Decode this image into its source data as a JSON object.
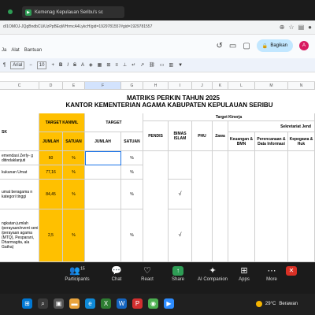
{
  "zoom": {
    "tab_title": "Kemenag Kepulauan Seribu's sc",
    "bottom": [
      {
        "label": "Participants",
        "icon": "participants-icon"
      },
      {
        "label": "Chat",
        "icon": "chat-icon"
      },
      {
        "label": "React",
        "icon": "react-icon"
      },
      {
        "label": "Share",
        "icon": "share-icon"
      },
      {
        "label": "AI Companion",
        "icon": "ai-companion-icon"
      },
      {
        "label": "Apps",
        "icon": "apps-icon"
      },
      {
        "label": "More",
        "icon": "more-icon"
      }
    ],
    "participant_count": "15"
  },
  "browser": {
    "url": "d/1OMOJ-JQgBndbCUiUzPpBEqWHrmcA4LykcH/gid=1929781557#gid=1929781557",
    "share_label": "Bagikan",
    "avatar_letter": "A"
  },
  "menu": [
    "Ja",
    "Alat",
    "Bantuan"
  ],
  "toolbar": {
    "font": "Arial",
    "size": "10"
  },
  "sheet": {
    "title1": "MATRIKS PERKIN TAHUN 2025",
    "title2": "KANTOR KEMENTERIAN AGAMA KABUPATEN KEPULAUAN SERIBU",
    "columns": [
      "C",
      "D",
      "E",
      "F",
      "G",
      "H",
      "I",
      "J",
      "K",
      "L",
      "M",
      "N"
    ],
    "headers": {
      "target_kanwil": "TARGET KANWIL",
      "target": "TARGET",
      "jumlah": "JUMLAH",
      "satuan": "SATUAN",
      "target_kinerja": "Target Kinerja",
      "sekretariat": "Sekretariat Jend",
      "pendis": "PENDIS",
      "bimas_islam": "BIMAS ISLAM",
      "phu": "PHU",
      "zawa": "Zawa",
      "keuangan": "Keuangan & BMN",
      "perencanaan": "Perencanaan & Data Informasi",
      "kepegawaian": "Kepegawa & Huk",
      "sk": "SK"
    },
    "rows": [
      {
        "desc": "emendasi Zerly- g ditindaklanjuti",
        "jumlah": "60",
        "satuan": "%",
        "pct": "%",
        "check": ""
      },
      {
        "desc": "kukunan Umat",
        "jumlah": "77,16",
        "satuan": "%",
        "pct": "%",
        "check": ""
      },
      {
        "desc": "umat beragama n kategori tinggi",
        "jumlah": "84,45",
        "satuan": "%",
        "pct": "%",
        "check": "√"
      },
      {
        "desc": "ngkatan jumlah /perayaan/event seni /perayaan agama (MTQ), Pesparani, Dharmagita, ala Gatha)",
        "jumlah": "2,5",
        "satuan": "%",
        "pct": "%",
        "check": "√"
      }
    ]
  },
  "taskbar": {
    "temperature": "29°C",
    "weather": "Berawan"
  }
}
